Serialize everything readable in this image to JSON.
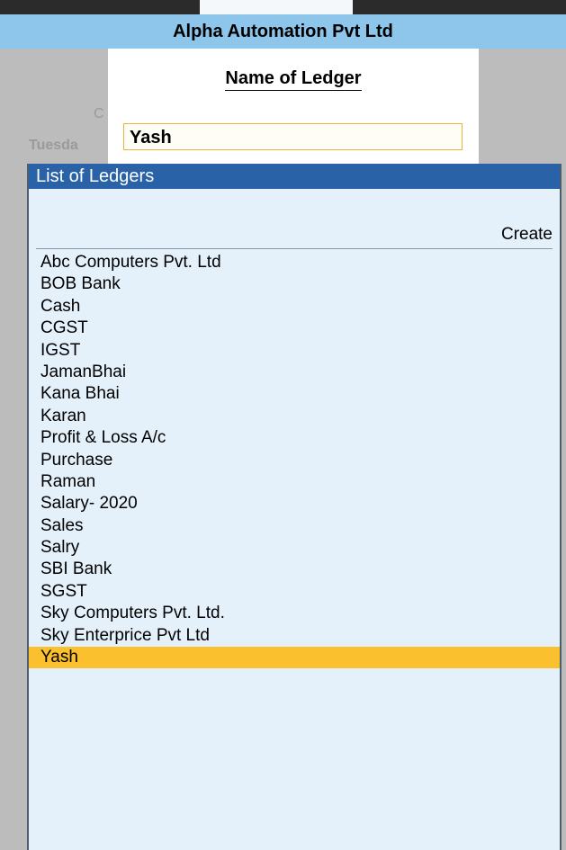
{
  "company": {
    "name": "Alpha Automation Pvt Ltd"
  },
  "background": {
    "partial_text_1": "C",
    "partial_text_2": "Tuesda"
  },
  "dialog": {
    "title": "Name of Ledger",
    "input_value": "Yash"
  },
  "list": {
    "header": "List of Ledgers",
    "create_label": "Create",
    "items": [
      "Abc Computers Pvt. Ltd",
      "BOB Bank",
      "Cash",
      "CGST",
      "IGST",
      "JamanBhai",
      "Kana Bhai",
      "Karan",
      "Profit & Loss A/c",
      "Purchase",
      "Raman",
      "Salary- 2020",
      "Sales",
      "Salry",
      "SBI Bank",
      "SGST",
      "Sky Computers Pvt. Ltd.",
      "Sky Enterprice Pvt Ltd",
      "Yash"
    ],
    "selected_item": "Yash"
  },
  "colors": {
    "accent_header": "#2a62a7",
    "company_bar": "#8ec5ea",
    "highlight": "#fbc02d",
    "list_bg": "#e4f1fb"
  }
}
